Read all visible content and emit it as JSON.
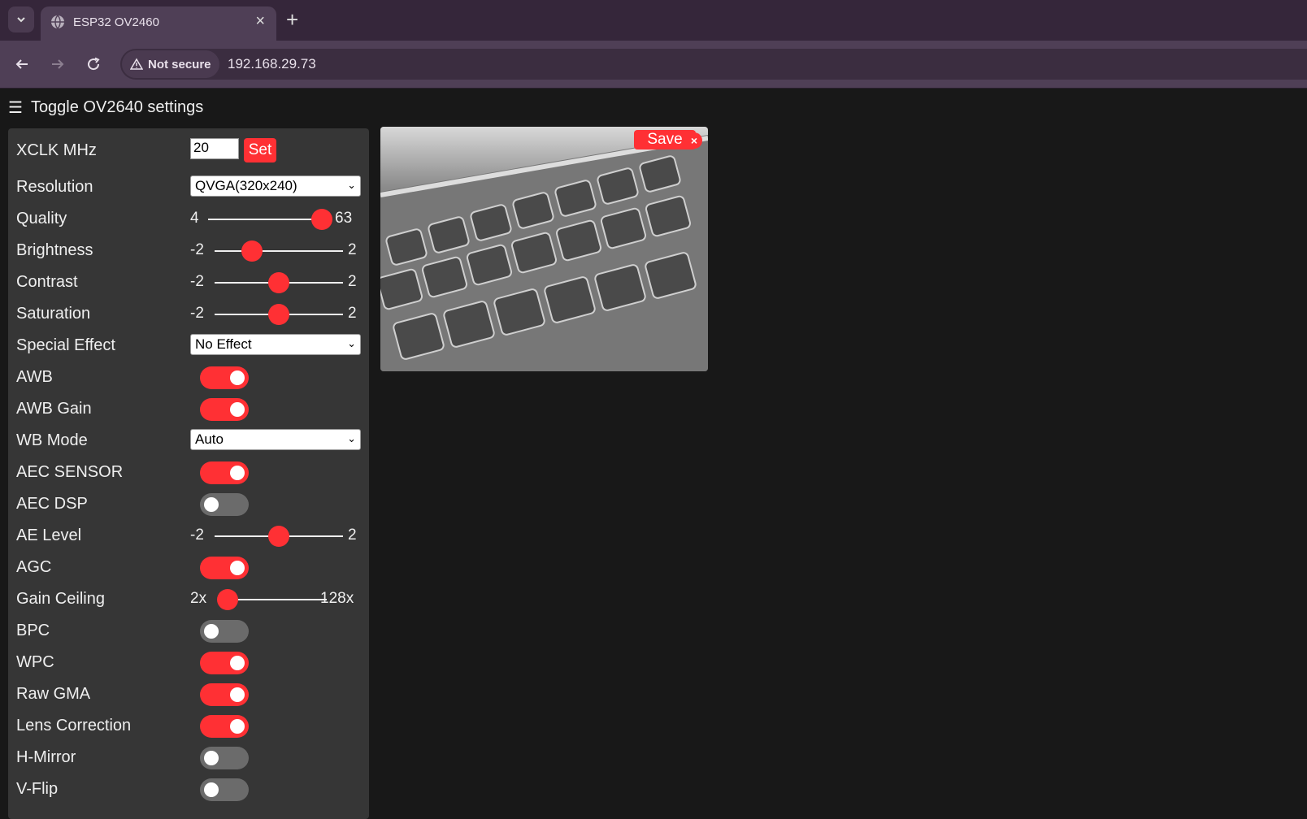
{
  "browser": {
    "tab_title": "ESP32 OV2460",
    "security_label": "Not secure",
    "url": "192.168.29.73"
  },
  "page": {
    "toggle_label": "Toggle OV2640 settings"
  },
  "controls": {
    "xclk": {
      "label": "XCLK MHz",
      "value": "20",
      "button": "Set"
    },
    "resolution": {
      "label": "Resolution",
      "value": "QVGA(320x240)"
    },
    "quality": {
      "label": "Quality",
      "min": "4",
      "max": "63",
      "value": 63
    },
    "brightness": {
      "label": "Brightness",
      "min": "-2",
      "max": "2",
      "value": -1
    },
    "contrast": {
      "label": "Contrast",
      "min": "-2",
      "max": "2",
      "value": 0
    },
    "saturation": {
      "label": "Saturation",
      "min": "-2",
      "max": "2",
      "value": 0
    },
    "special_effect": {
      "label": "Special Effect",
      "value": "No Effect"
    },
    "awb": {
      "label": "AWB",
      "on": true
    },
    "awb_gain": {
      "label": "AWB Gain",
      "on": true
    },
    "wb_mode": {
      "label": "WB Mode",
      "value": "Auto"
    },
    "aec_sensor": {
      "label": "AEC SENSOR",
      "on": true
    },
    "aec_dsp": {
      "label": "AEC DSP",
      "on": false
    },
    "ae_level": {
      "label": "AE Level",
      "min": "-2",
      "max": "2",
      "value": 0
    },
    "agc": {
      "label": "AGC",
      "on": true
    },
    "gain_ceiling": {
      "label": "Gain Ceiling",
      "min": "2x",
      "max": "128x",
      "value": 0
    },
    "bpc": {
      "label": "BPC",
      "on": false
    },
    "wpc": {
      "label": "WPC",
      "on": true
    },
    "raw_gma": {
      "label": "Raw GMA",
      "on": true
    },
    "lens_correction": {
      "label": "Lens Correction",
      "on": true
    },
    "h_mirror": {
      "label": "H-Mirror",
      "on": false
    },
    "v_flip": {
      "label": "V-Flip",
      "on": false
    }
  },
  "stream": {
    "save_label": "Save",
    "close_label": "×"
  },
  "colors": {
    "accent": "#ff3034",
    "panel": "#363636",
    "background": "#181818"
  }
}
